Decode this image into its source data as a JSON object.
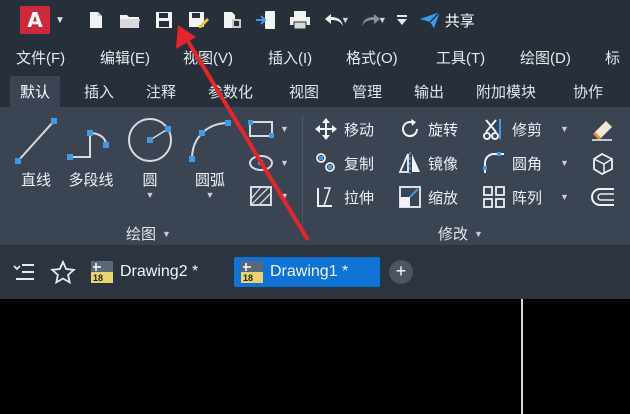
{
  "app": {
    "logo_letter": "A"
  },
  "quick_access": {
    "icons": [
      "new-file-icon",
      "open-folder-icon",
      "save-icon",
      "save-as-icon",
      "plot-publish-icon",
      "export-icon",
      "print-icon",
      "undo-icon",
      "redo-icon",
      "customize-caret-icon",
      "share-icon"
    ],
    "share_label": "共享"
  },
  "menu": {
    "items": [
      "文件(F)",
      "编辑(E)",
      "视图(V)",
      "插入(I)",
      "格式(O)",
      "工具(T)",
      "绘图(D)",
      "标"
    ]
  },
  "ribbon_tabs": {
    "items": [
      "默认",
      "插入",
      "注释",
      "参数化",
      "视图",
      "管理",
      "输出",
      "附加模块",
      "协作"
    ],
    "active": "默认"
  },
  "draw_panel": {
    "title": "绘图",
    "tools": {
      "line": "直线",
      "polyline": "多段线",
      "circle": "圆",
      "arc": "圆弧"
    }
  },
  "modify_panel": {
    "title": "修改",
    "tools": {
      "move": "移动",
      "rotate": "旋转",
      "trim": "修剪",
      "copy": "复制",
      "mirror": "镜像",
      "fillet": "圆角",
      "stretch": "拉伸",
      "scale": "缩放",
      "array": "阵列"
    }
  },
  "file_tabs": {
    "tabs": [
      {
        "label": "Drawing2 *",
        "badge": "18",
        "active": false
      },
      {
        "label": "Drawing1 *",
        "badge": "18",
        "active": true
      }
    ],
    "new_tab_symbol": "+"
  },
  "colors": {
    "accent": "#0f73d6",
    "title_bar": "#272f3b",
    "ribbon": "#3b4453",
    "arrow": "#e3262b",
    "logo": "#cc2a3a"
  }
}
